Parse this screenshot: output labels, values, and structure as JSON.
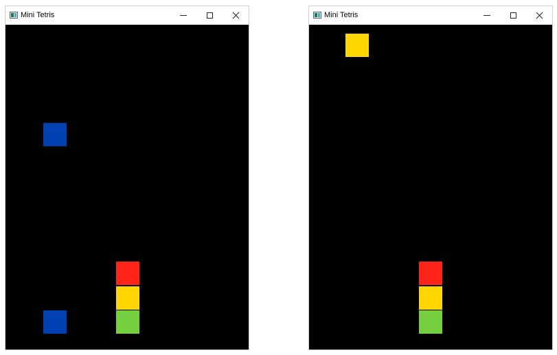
{
  "colors": {
    "board_bg": "#000000",
    "blue": "#0041b3",
    "red": "#ff2318",
    "yellow": "#ffd600",
    "green": "#76cf3f"
  },
  "windows": [
    {
      "title": "Mini Tetris",
      "icon": "app-window-icon",
      "controls": [
        "minimize-icon",
        "maximize-icon",
        "close-icon"
      ],
      "blocks": [
        {
          "color": "blue",
          "state": "falling"
        },
        {
          "color": "blue",
          "state": "landed"
        },
        {
          "color": "red",
          "state": "landed"
        },
        {
          "color": "yellow",
          "state": "landed"
        },
        {
          "color": "green",
          "state": "landed"
        }
      ]
    },
    {
      "title": "Mini Tetris",
      "icon": "app-window-icon",
      "controls": [
        "minimize-icon",
        "maximize-icon",
        "close-icon"
      ],
      "blocks": [
        {
          "color": "yellow",
          "state": "falling"
        },
        {
          "color": "red",
          "state": "landed"
        },
        {
          "color": "yellow",
          "state": "landed"
        },
        {
          "color": "green",
          "state": "landed"
        }
      ]
    }
  ]
}
